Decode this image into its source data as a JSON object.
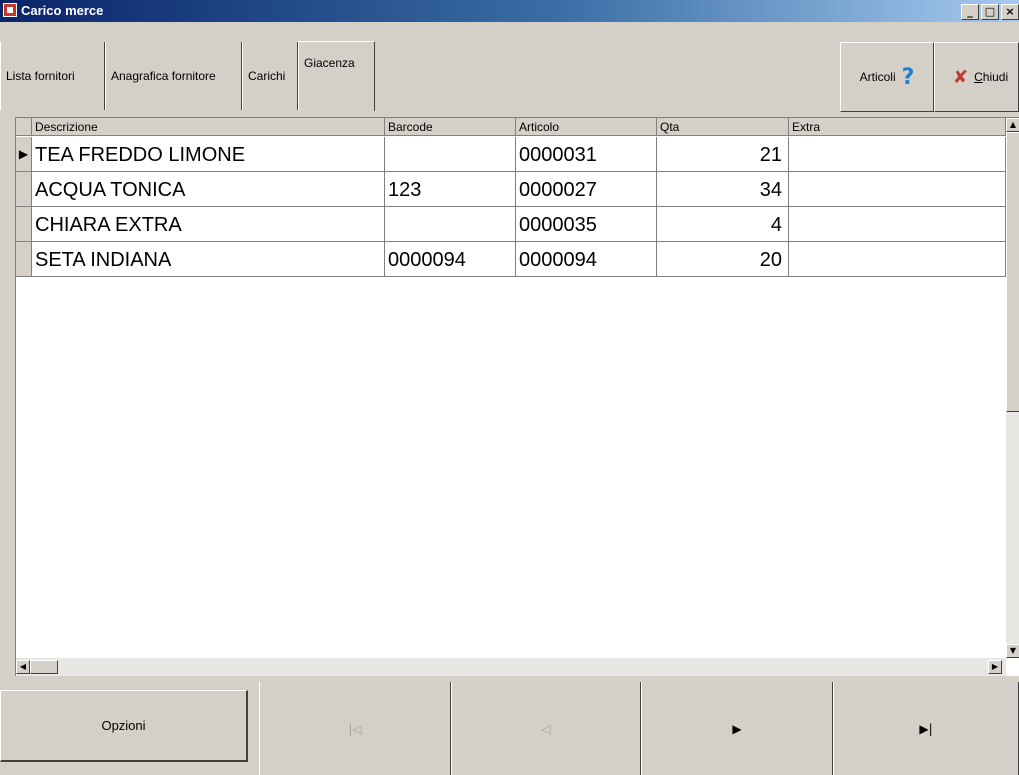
{
  "window": {
    "title": "Carico merce",
    "controls": {
      "minimize": "_",
      "maximize": "□",
      "close": "×"
    }
  },
  "tabs": [
    {
      "label": "Lista fornitori",
      "active": false
    },
    {
      "label": "Anagrafica fornitore",
      "active": false
    },
    {
      "label": "Carichi",
      "active": false
    },
    {
      "label": "Giacenza",
      "active": true
    }
  ],
  "toolbar": {
    "articoli_label": "Articoli",
    "articoli_icon": "help-icon",
    "chiudi_label_mnemonic": "C",
    "chiudi_label_rest": "hiudi",
    "chiudi_icon": "close-x-icon"
  },
  "grid": {
    "columns": [
      "Descrizione",
      "Barcode",
      "Articolo",
      "Qta",
      "Extra"
    ],
    "rows": [
      {
        "descrizione": "TEA FREDDO LIMONE",
        "barcode": "",
        "articolo": "0000031",
        "qta": "21",
        "extra": "",
        "current": true
      },
      {
        "descrizione": "ACQUA TONICA",
        "barcode": "123",
        "articolo": "0000027",
        "qta": "34",
        "extra": "",
        "current": false
      },
      {
        "descrizione": "CHIARA EXTRA",
        "barcode": "",
        "articolo": "0000035",
        "qta": "4",
        "extra": "",
        "current": false
      },
      {
        "descrizione": "SETA INDIANA",
        "barcode": "0000094",
        "articolo": "0000094",
        "qta": "20",
        "extra": "",
        "current": false
      }
    ]
  },
  "navigator": {
    "options_label": "Opzioni",
    "first_icon": "first-record-icon",
    "prior_icon": "prior-record-icon",
    "next_icon": "next-record-icon",
    "last_icon": "last-record-icon"
  },
  "colors": {
    "title_bar_start": "#0a246a",
    "title_bar_end": "#a6caf0",
    "face": "#d4d0c8",
    "help_icon": "#1e7fd6",
    "close_icon": "#c0392b"
  }
}
